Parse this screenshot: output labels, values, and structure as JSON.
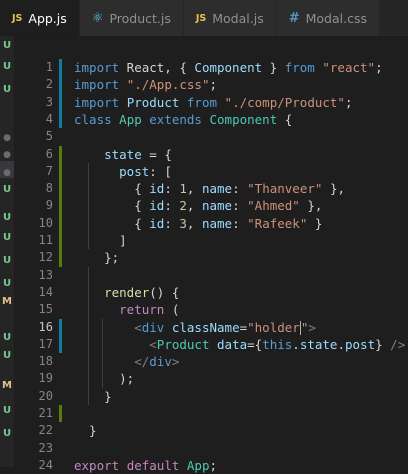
{
  "tabs": [
    {
      "icon": "JS",
      "label": "App.js",
      "active": true
    },
    {
      "icon": "⚛",
      "label": "Product.js",
      "active": false
    },
    {
      "icon": "JS",
      "label": "Modal.js",
      "active": false
    },
    {
      "icon": "#",
      "label": "Modal.css",
      "active": false
    }
  ],
  "gutter_marks": [
    {
      "text": "U",
      "kind": "u"
    },
    {
      "text": "U",
      "kind": "u"
    },
    {
      "text": "U",
      "kind": "u"
    },
    {
      "text": "●",
      "kind": "dot"
    },
    {
      "text": "●",
      "kind": "dot"
    },
    {
      "text": "●",
      "kind": "dot"
    },
    {
      "text": "U",
      "kind": "u"
    },
    {
      "text": "U",
      "kind": "u"
    },
    {
      "text": "U",
      "kind": "u"
    },
    {
      "text": "U",
      "kind": "u"
    },
    {
      "text": "U",
      "kind": "u"
    },
    {
      "text": "M",
      "kind": "m"
    },
    {
      "text": "U",
      "kind": "u"
    },
    {
      "text": "U",
      "kind": "u"
    },
    {
      "text": "M",
      "kind": "m"
    },
    {
      "text": "U",
      "kind": "u"
    },
    {
      "text": "U",
      "kind": "u"
    }
  ],
  "editor": {
    "current_line": 16,
    "lines": [
      [
        [
          "k",
          "import"
        ],
        [
          "p",
          " React, { "
        ],
        [
          "v",
          "Component"
        ],
        [
          "p",
          " } "
        ],
        [
          "k",
          "from"
        ],
        [
          "p",
          " "
        ],
        [
          "s",
          "\"react\""
        ],
        [
          "p",
          ";"
        ]
      ],
      [
        [
          "k",
          "import"
        ],
        [
          "p",
          " "
        ],
        [
          "s",
          "\"./App.css\""
        ],
        [
          "p",
          ";"
        ]
      ],
      [
        [
          "k",
          "import"
        ],
        [
          "p",
          " "
        ],
        [
          "v",
          "Product"
        ],
        [
          "p",
          " "
        ],
        [
          "k",
          "from"
        ],
        [
          "p",
          " "
        ],
        [
          "s",
          "\"./comp/Product\""
        ],
        [
          "p",
          ";"
        ]
      ],
      [
        [
          "k",
          "class"
        ],
        [
          "p",
          " "
        ],
        [
          "t",
          "App"
        ],
        [
          "p",
          " "
        ],
        [
          "k",
          "extends"
        ],
        [
          "p",
          " "
        ],
        [
          "t",
          "Component"
        ],
        [
          "p",
          " {"
        ]
      ],
      [],
      [
        [
          "p",
          "    "
        ],
        [
          "v",
          "state"
        ],
        [
          "p",
          " = {"
        ]
      ],
      [
        [
          "p",
          "      "
        ],
        [
          "v",
          "post"
        ],
        [
          "p",
          ": ["
        ]
      ],
      [
        [
          "p",
          "        { "
        ],
        [
          "v",
          "id"
        ],
        [
          "p",
          ": "
        ],
        [
          "n",
          "1"
        ],
        [
          "p",
          ", "
        ],
        [
          "v",
          "name"
        ],
        [
          "p",
          ": "
        ],
        [
          "s",
          "\"Thanveer\""
        ],
        [
          "p",
          " },"
        ]
      ],
      [
        [
          "p",
          "        { "
        ],
        [
          "v",
          "id"
        ],
        [
          "p",
          ": "
        ],
        [
          "n",
          "2"
        ],
        [
          "p",
          ", "
        ],
        [
          "v",
          "name"
        ],
        [
          "p",
          ": "
        ],
        [
          "s",
          "\"Ahmed\""
        ],
        [
          "p",
          " },"
        ]
      ],
      [
        [
          "p",
          "        { "
        ],
        [
          "v",
          "id"
        ],
        [
          "p",
          ": "
        ],
        [
          "n",
          "3"
        ],
        [
          "p",
          ", "
        ],
        [
          "v",
          "name"
        ],
        [
          "p",
          ": "
        ],
        [
          "s",
          "\"Rafeek\""
        ],
        [
          "p",
          " }"
        ]
      ],
      [
        [
          "p",
          "      ]"
        ]
      ],
      [
        [
          "p",
          "    };"
        ]
      ],
      [],
      [
        [
          "p",
          "    "
        ],
        [
          "f",
          "render"
        ],
        [
          "p",
          "() {"
        ]
      ],
      [
        [
          "p",
          "      "
        ],
        [
          "c",
          "return"
        ],
        [
          "p",
          " ("
        ]
      ],
      [
        [
          "p",
          "        "
        ],
        [
          "g",
          "<"
        ],
        [
          "j",
          "div"
        ],
        [
          "p",
          " "
        ],
        [
          "a",
          "className"
        ],
        [
          "p",
          "="
        ],
        [
          "s",
          "\"holder\""
        ],
        [
          "g",
          ">"
        ]
      ],
      [
        [
          "p",
          "          "
        ],
        [
          "g",
          "<"
        ],
        [
          "t",
          "Product"
        ],
        [
          "p",
          " "
        ],
        [
          "a",
          "data"
        ],
        [
          "p",
          "={"
        ],
        [
          "k",
          "this"
        ],
        [
          "p",
          "."
        ],
        [
          "v",
          "state"
        ],
        [
          "p",
          "."
        ],
        [
          "v",
          "post"
        ],
        [
          "p",
          "} "
        ],
        [
          "g",
          "/>"
        ]
      ],
      [
        [
          "p",
          "        "
        ],
        [
          "g",
          "</"
        ],
        [
          "j",
          "div"
        ],
        [
          "g",
          ">"
        ]
      ],
      [
        [
          "p",
          "      );"
        ]
      ],
      [
        [
          "p",
          "    }"
        ]
      ],
      [],
      [
        [
          "p",
          "  }"
        ]
      ],
      [],
      [
        [
          "c",
          "export"
        ],
        [
          "p",
          " "
        ],
        [
          "c",
          "default"
        ],
        [
          "p",
          " "
        ],
        [
          "t",
          "App"
        ],
        [
          "p",
          ";"
        ]
      ]
    ]
  },
  "colors": {
    "background": "#1e1e1e",
    "keyword": "#569cd6",
    "control": "#c586c0",
    "string": "#ce9178",
    "variable": "#9cdcfe",
    "type": "#4ec9b0",
    "number": "#b5cea8",
    "function": "#dcdcaa"
  }
}
